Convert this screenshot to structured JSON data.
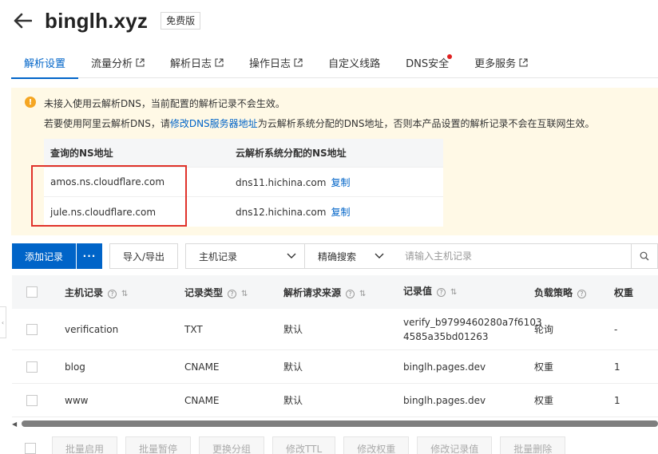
{
  "header": {
    "title": "binglh.xyz",
    "plan_badge": "免费版",
    "back_icon": "arrow-left-icon"
  },
  "tabs": [
    {
      "label": "解析设置",
      "active": true,
      "external": false,
      "dot": false
    },
    {
      "label": "流量分析",
      "active": false,
      "external": true,
      "dot": false
    },
    {
      "label": "解析日志",
      "active": false,
      "external": true,
      "dot": false
    },
    {
      "label": "操作日志",
      "active": false,
      "external": true,
      "dot": false
    },
    {
      "label": "自定义线路",
      "active": false,
      "external": false,
      "dot": false
    },
    {
      "label": "DNS安全",
      "active": false,
      "external": false,
      "dot": true
    },
    {
      "label": "更多服务",
      "active": false,
      "external": true,
      "dot": false
    }
  ],
  "warning": {
    "line1": "未接入使用云解析DNS，当前配置的解析记录不会生效。",
    "line2_prefix": "若要使用阿里云解析DNS，请",
    "line2_link": "修改DNS服务器地址",
    "line2_suffix": "为云解析系统分配的DNS地址，否则本产品设置的解析记录不会在互联网生效。",
    "ns_table": {
      "headers": [
        "查询的NS地址",
        "云解析系统分配的NS地址"
      ],
      "rows": [
        {
          "queried": "amos.ns.cloudflare.com",
          "assigned": "dns11.hichina.com",
          "copy": "复制"
        },
        {
          "queried": "jule.ns.cloudflare.com",
          "assigned": "dns12.hichina.com",
          "copy": "复制"
        }
      ]
    }
  },
  "toolbar": {
    "add_record": "添加记录",
    "more": "···",
    "import_export": "导入/导出",
    "field_select": "主机记录",
    "match_select": "精确搜索",
    "search_placeholder": "请输入主机记录"
  },
  "records": {
    "headers": {
      "host": "主机记录",
      "type": "记录类型",
      "source": "解析请求来源",
      "value": "记录值",
      "lb": "负载策略",
      "weight": "权重"
    },
    "rows": [
      {
        "host": "verification",
        "type": "TXT",
        "source": "默认",
        "value_line1": "verify_b9799460280a7f6103",
        "value_line2": "4585a35bd01263",
        "lb": "轮询",
        "weight": "-"
      },
      {
        "host": "blog",
        "type": "CNAME",
        "source": "默认",
        "value_line1": "binglh.pages.dev",
        "value_line2": "",
        "lb": "权重",
        "weight": "1"
      },
      {
        "host": "www",
        "type": "CNAME",
        "source": "默认",
        "value_line1": "binglh.pages.dev",
        "value_line2": "",
        "lb": "权重",
        "weight": "1"
      }
    ]
  },
  "batch": [
    "批量启用",
    "批量暂停",
    "更换分组",
    "修改TTL",
    "修改权重",
    "修改记录值",
    "批量删除"
  ],
  "colors": {
    "accent": "#0064c8",
    "warning_bg": "#fff9e6",
    "highlight_box": "#e0322a",
    "dot": "#e02020"
  }
}
